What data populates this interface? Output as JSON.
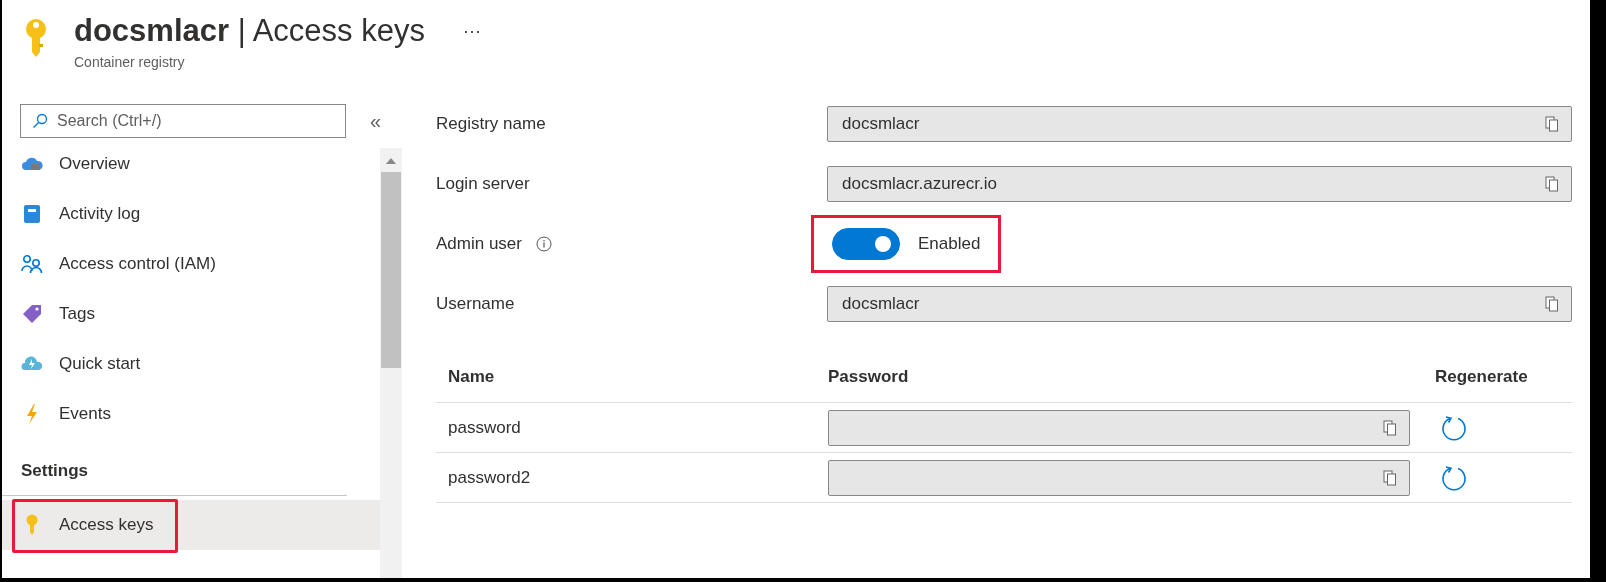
{
  "header": {
    "title": "**docsmlacr** | Access keys",
    "subtitle": "Container registry",
    "more": "···"
  },
  "sidebar": {
    "search": {
      "placeholder": "Search (Ctrl+/)"
    },
    "collapse": "«",
    "items": [
      {
        "label": "Overview",
        "selected": false,
        "highlighted": false
      },
      {
        "label": "Activity log",
        "selected": false,
        "highlighted": false
      },
      {
        "label": "Access control (IAM)",
        "selected": false,
        "highlighted": false
      },
      {
        "label": "Tags",
        "selected": false,
        "highlighted": false
      },
      {
        "label": "Quick start",
        "selected": false,
        "highlighted": false
      },
      {
        "label": "Events",
        "selected": false,
        "highlighted": false
      }
    ],
    "sections": [
      {
        "title": "Settings",
        "items": [
          {
            "label": "Access keys",
            "selected": true,
            "highlighted": true
          }
        ]
      }
    ]
  },
  "fields": [
    {
      "kind": "text",
      "label": "Registry name",
      "value": "docsmlacr"
    },
    {
      "kind": "text",
      "label": "Login server",
      "value": "docsmlacr.azurecr.io"
    },
    {
      "kind": "toggle",
      "label": "Admin user",
      "info": true,
      "on": true,
      "state_label": "Enabled",
      "highlighted": true
    },
    {
      "kind": "text",
      "label": "Username",
      "value": "docsmlacr"
    }
  ],
  "passwords": {
    "columns": [
      "Name",
      "Password",
      "Regenerate"
    ],
    "rows": [
      {
        "name": "password"
      },
      {
        "name": "password2"
      }
    ]
  }
}
